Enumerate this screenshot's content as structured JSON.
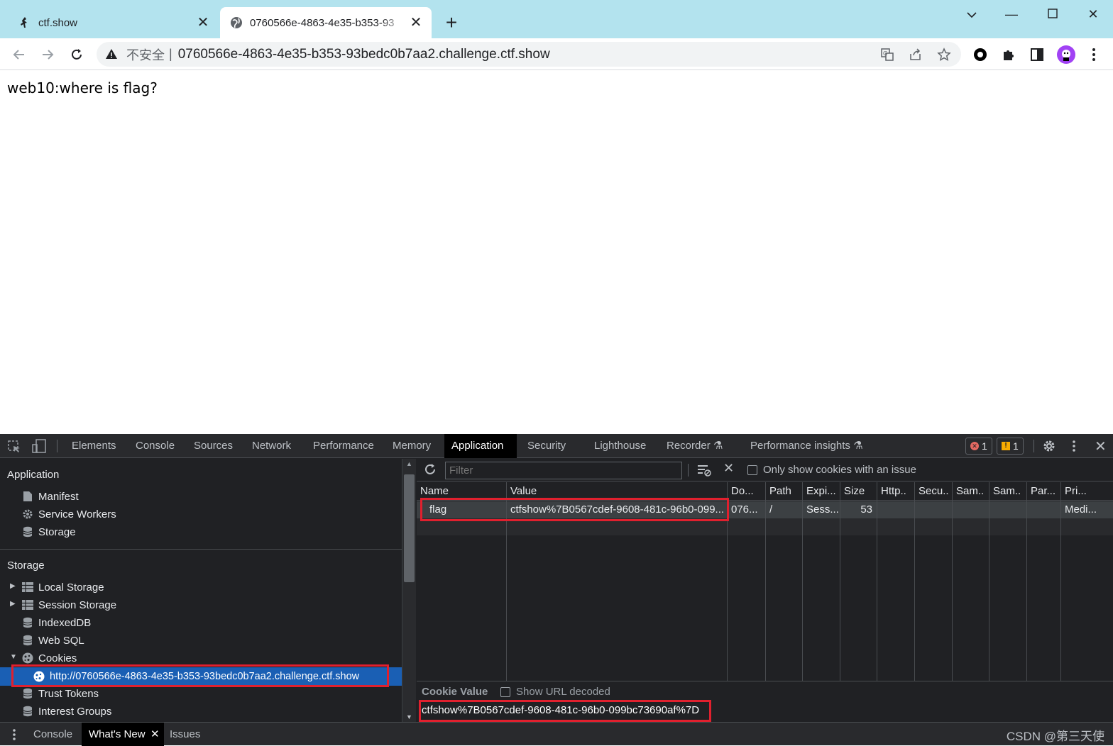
{
  "browser": {
    "tabs": [
      {
        "title": "ctf.show",
        "icon": "ctfshow-runner-icon"
      },
      {
        "title": "0760566e-4863-4e35-b353-93",
        "icon": "globe-icon"
      }
    ],
    "address": {
      "security_label": "不安全",
      "url": "0760566e-4863-4e35-b353-93bedc0b7aa2.challenge.ctf.show"
    }
  },
  "page": {
    "text": "web10:where is flag?"
  },
  "devtools": {
    "tabs": [
      "Elements",
      "Console",
      "Sources",
      "Network",
      "Performance",
      "Memory",
      "Application",
      "Security",
      "Lighthouse",
      "Recorder",
      "Performance insights"
    ],
    "active_tab": "Application",
    "error_count": "1",
    "warning_count": "1",
    "sidebar": {
      "application_title": "Application",
      "application_items": [
        "Manifest",
        "Service Workers",
        "Storage"
      ],
      "storage_title": "Storage",
      "storage_items": [
        "Local Storage",
        "Session Storage",
        "IndexedDB",
        "Web SQL",
        "Cookies"
      ],
      "cookie_origin": "http://0760566e-4863-4e35-b353-93bedc0b7aa2.challenge.ctf.show",
      "after_items": [
        "Trust Tokens",
        "Interest Groups"
      ]
    },
    "filter": {
      "placeholder": "Filter",
      "only_issue_label": "Only show cookies with an issue"
    },
    "table": {
      "columns": [
        "Name",
        "Value",
        "Do...",
        "Path",
        "Expi...",
        "Size",
        "Http..",
        "Secu..",
        "Sam..",
        "Sam..",
        "Par...",
        "Pri..."
      ],
      "rows": [
        [
          "flag",
          "ctfshow%7B0567cdef-9608-481c-96b0-099...",
          "076...",
          "/",
          "Sess...",
          "53",
          "",
          "",
          "",
          "",
          "",
          "Medi..."
        ]
      ]
    },
    "cookie_value": {
      "label": "Cookie Value",
      "decode_label": "Show URL decoded",
      "value": "ctfshow%7B0567cdef-9608-481c-96b0-099bc73690af%7D"
    },
    "drawer": {
      "tabs": [
        "Console",
        "What's New",
        "Issues"
      ],
      "active": "What's New"
    }
  },
  "watermark": "CSDN @第三天使"
}
